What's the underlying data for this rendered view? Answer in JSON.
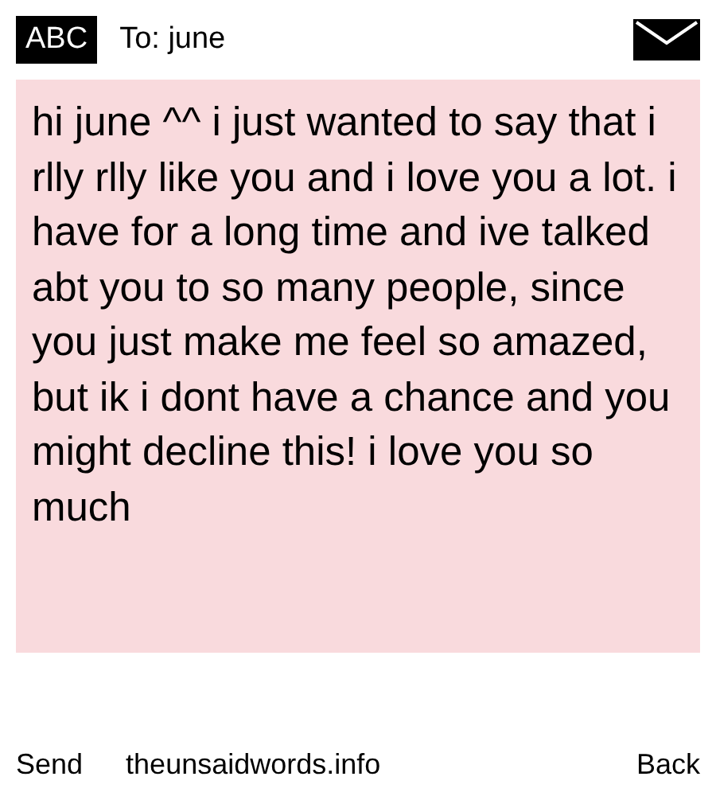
{
  "header": {
    "mode_badge": "ABC",
    "recipient": "To: june"
  },
  "message": "hi june ^^ i just wanted to say that i rlly rlly like you and i love you a lot. i have for a long time and ive talked abt you to so many people, since you just make me feel so amazed, but ik i dont have a chance and you might decline this! i love you so much",
  "footer": {
    "left_action": "Send",
    "site": "theunsaidwords.info",
    "right_action": "Back"
  }
}
